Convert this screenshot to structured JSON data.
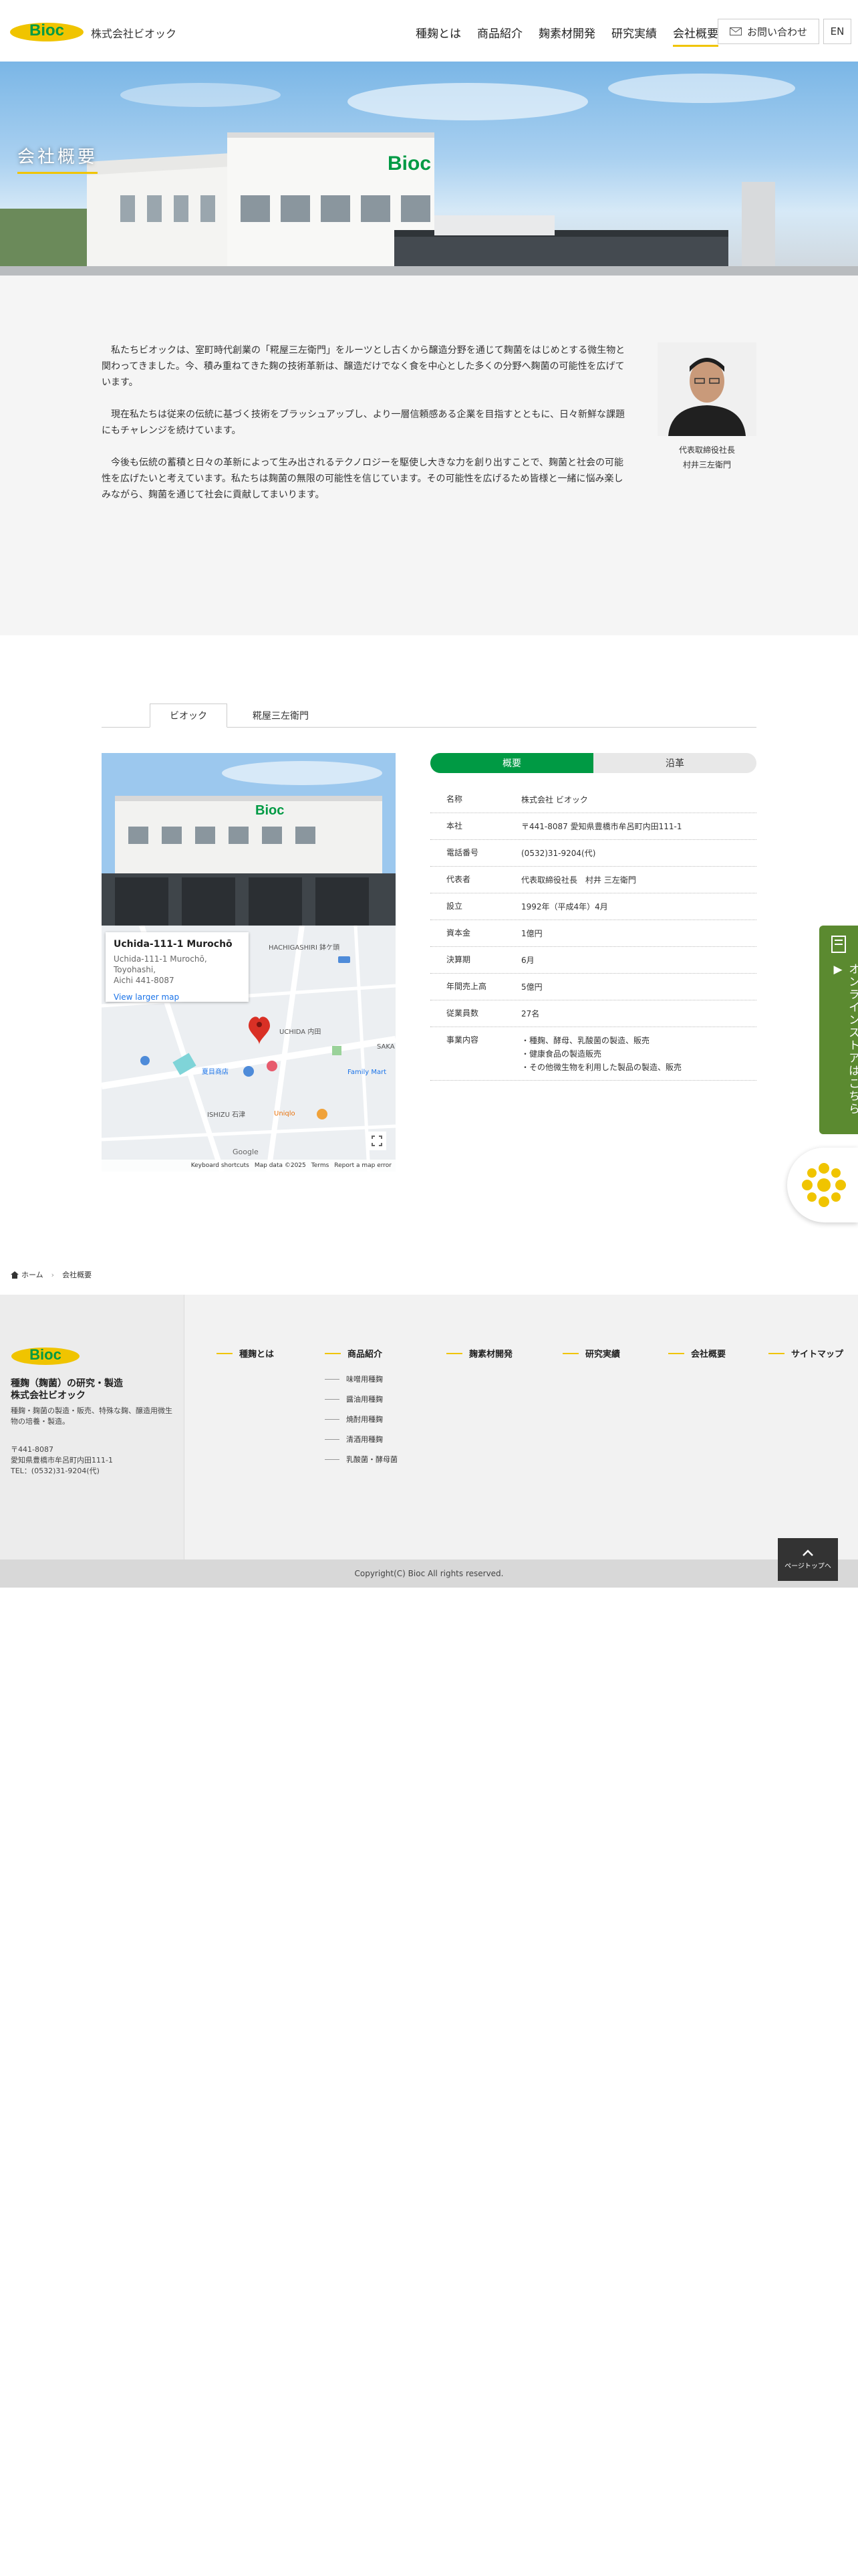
{
  "header": {
    "logo_text": "Bioc",
    "company_name": "株式会社ビオック",
    "nav": [
      "種麹とは",
      "商品紹介",
      "麹素材開発",
      "研究実績",
      "会社概要"
    ],
    "active_nav": "会社概要",
    "contact_label": "お問い合わせ",
    "lang_label": "EN"
  },
  "hero": {
    "title": "会社概要"
  },
  "intro": {
    "paragraphs": [
      "私たちビオックは、室町時代創業の「糀屋三左衛門」をルーツとし古くから醸造分野を通じて麹菌をはじめとする微生物と関わってきました。今、積み重ねてきた麹の技術革新は、醸造だけでなく食を中心とした多くの分野へ麹菌の可能性を広げています。",
      "現在私たちは従来の伝統に基づく技術をブラッシュアップし、より一層信頼感ある企業を目指すとともに、日々新鮮な課題にもチャレンジを続けています。",
      "今後も伝統の蓄積と日々の革新によって生み出されるテクノロジーを駆使し大きな力を創り出すことで、麹菌と社会の可能性を広げたいと考えています。私たちは麹菌の無限の可能性を信じています。その可能性を広げるため皆様と一緒に悩み楽しみながら、麹菌を通じて社会に貢献してまいります。"
    ],
    "ceo_title": "代表取締役社長",
    "ceo_name": "村井三左衛門"
  },
  "tabs": [
    "ビオック",
    "糀屋三左衛門"
  ],
  "map": {
    "place_title": "Uchida-111-1 Murochō",
    "place_addr_line1": "Uchida-111-1 Murochō, Toyohashi,",
    "place_addr_line2": "Aichi 441-8087",
    "larger_map": "View larger map",
    "footer": [
      "Keyboard shortcuts",
      "Map data ©2025",
      "Terms",
      "Report a map error"
    ],
    "labels": [
      "HACHIGASHIRI 鉢ケ頭",
      "UCHIDA 内田",
      "SAKA",
      "Family Mart",
      "夏目商店",
      "Uniqlo",
      "ISHIZU 石津",
      "Google"
    ]
  },
  "profile": {
    "toggle": [
      "概要",
      "沿革"
    ],
    "rows": [
      {
        "label": "名称",
        "value": "株式会社 ビオック"
      },
      {
        "label": "本社",
        "value": "〒441-8087 愛知県豊橋市牟呂町内田111-1"
      },
      {
        "label": "電話番号",
        "value": "(0532)31-9204(代)"
      },
      {
        "label": "代表者",
        "value": "代表取締役社長　村井 三左衛門"
      },
      {
        "label": "設立",
        "value": "1992年（平成4年）4月"
      },
      {
        "label": "資本金",
        "value": "1億円"
      },
      {
        "label": "決算期",
        "value": "6月"
      },
      {
        "label": "年間売上高",
        "value": "5億円"
      },
      {
        "label": "従業員数",
        "value": "27名"
      },
      {
        "label": "事業内容",
        "value": "・種麹、酵母、乳酸菌の製造、販売\n・健康食品の製造販売\n・その他微生物を利用した製品の製造、販売"
      }
    ]
  },
  "side": {
    "store_label": "オンラインストアはこちら ▶"
  },
  "breadcrumb": {
    "home": "ホーム",
    "current": "会社概要"
  },
  "footer": {
    "tagline_1": "種麹（麹菌）の研究・製造",
    "tagline_2": "株式会社ビオック",
    "desc": "種麹・麹菌の製造・販売、特殊な麹、醸造用微生物の培養・製造。",
    "postal": "〒441-8087",
    "address": "愛知県豊橋市牟呂町内田111-1",
    "tel": "TEL：(0532)31-9204(代)",
    "nav": [
      "種麹とは",
      "商品紹介",
      "麹素材開発",
      "研究実績",
      "会社概要",
      "サイトマップ"
    ],
    "sub_items": [
      "味噌用種麹",
      "醤油用種麹",
      "焼酎用種麹",
      "清酒用種麹",
      "乳酸菌・酵母菌"
    ],
    "copyright": "Copyright(C) Bioc All rights reserved.",
    "pagetop": "ページトップへ"
  },
  "colors": {
    "brand_green": "#009a44",
    "accent_yellow": "#f0c400",
    "store_green": "#5b8a30"
  }
}
